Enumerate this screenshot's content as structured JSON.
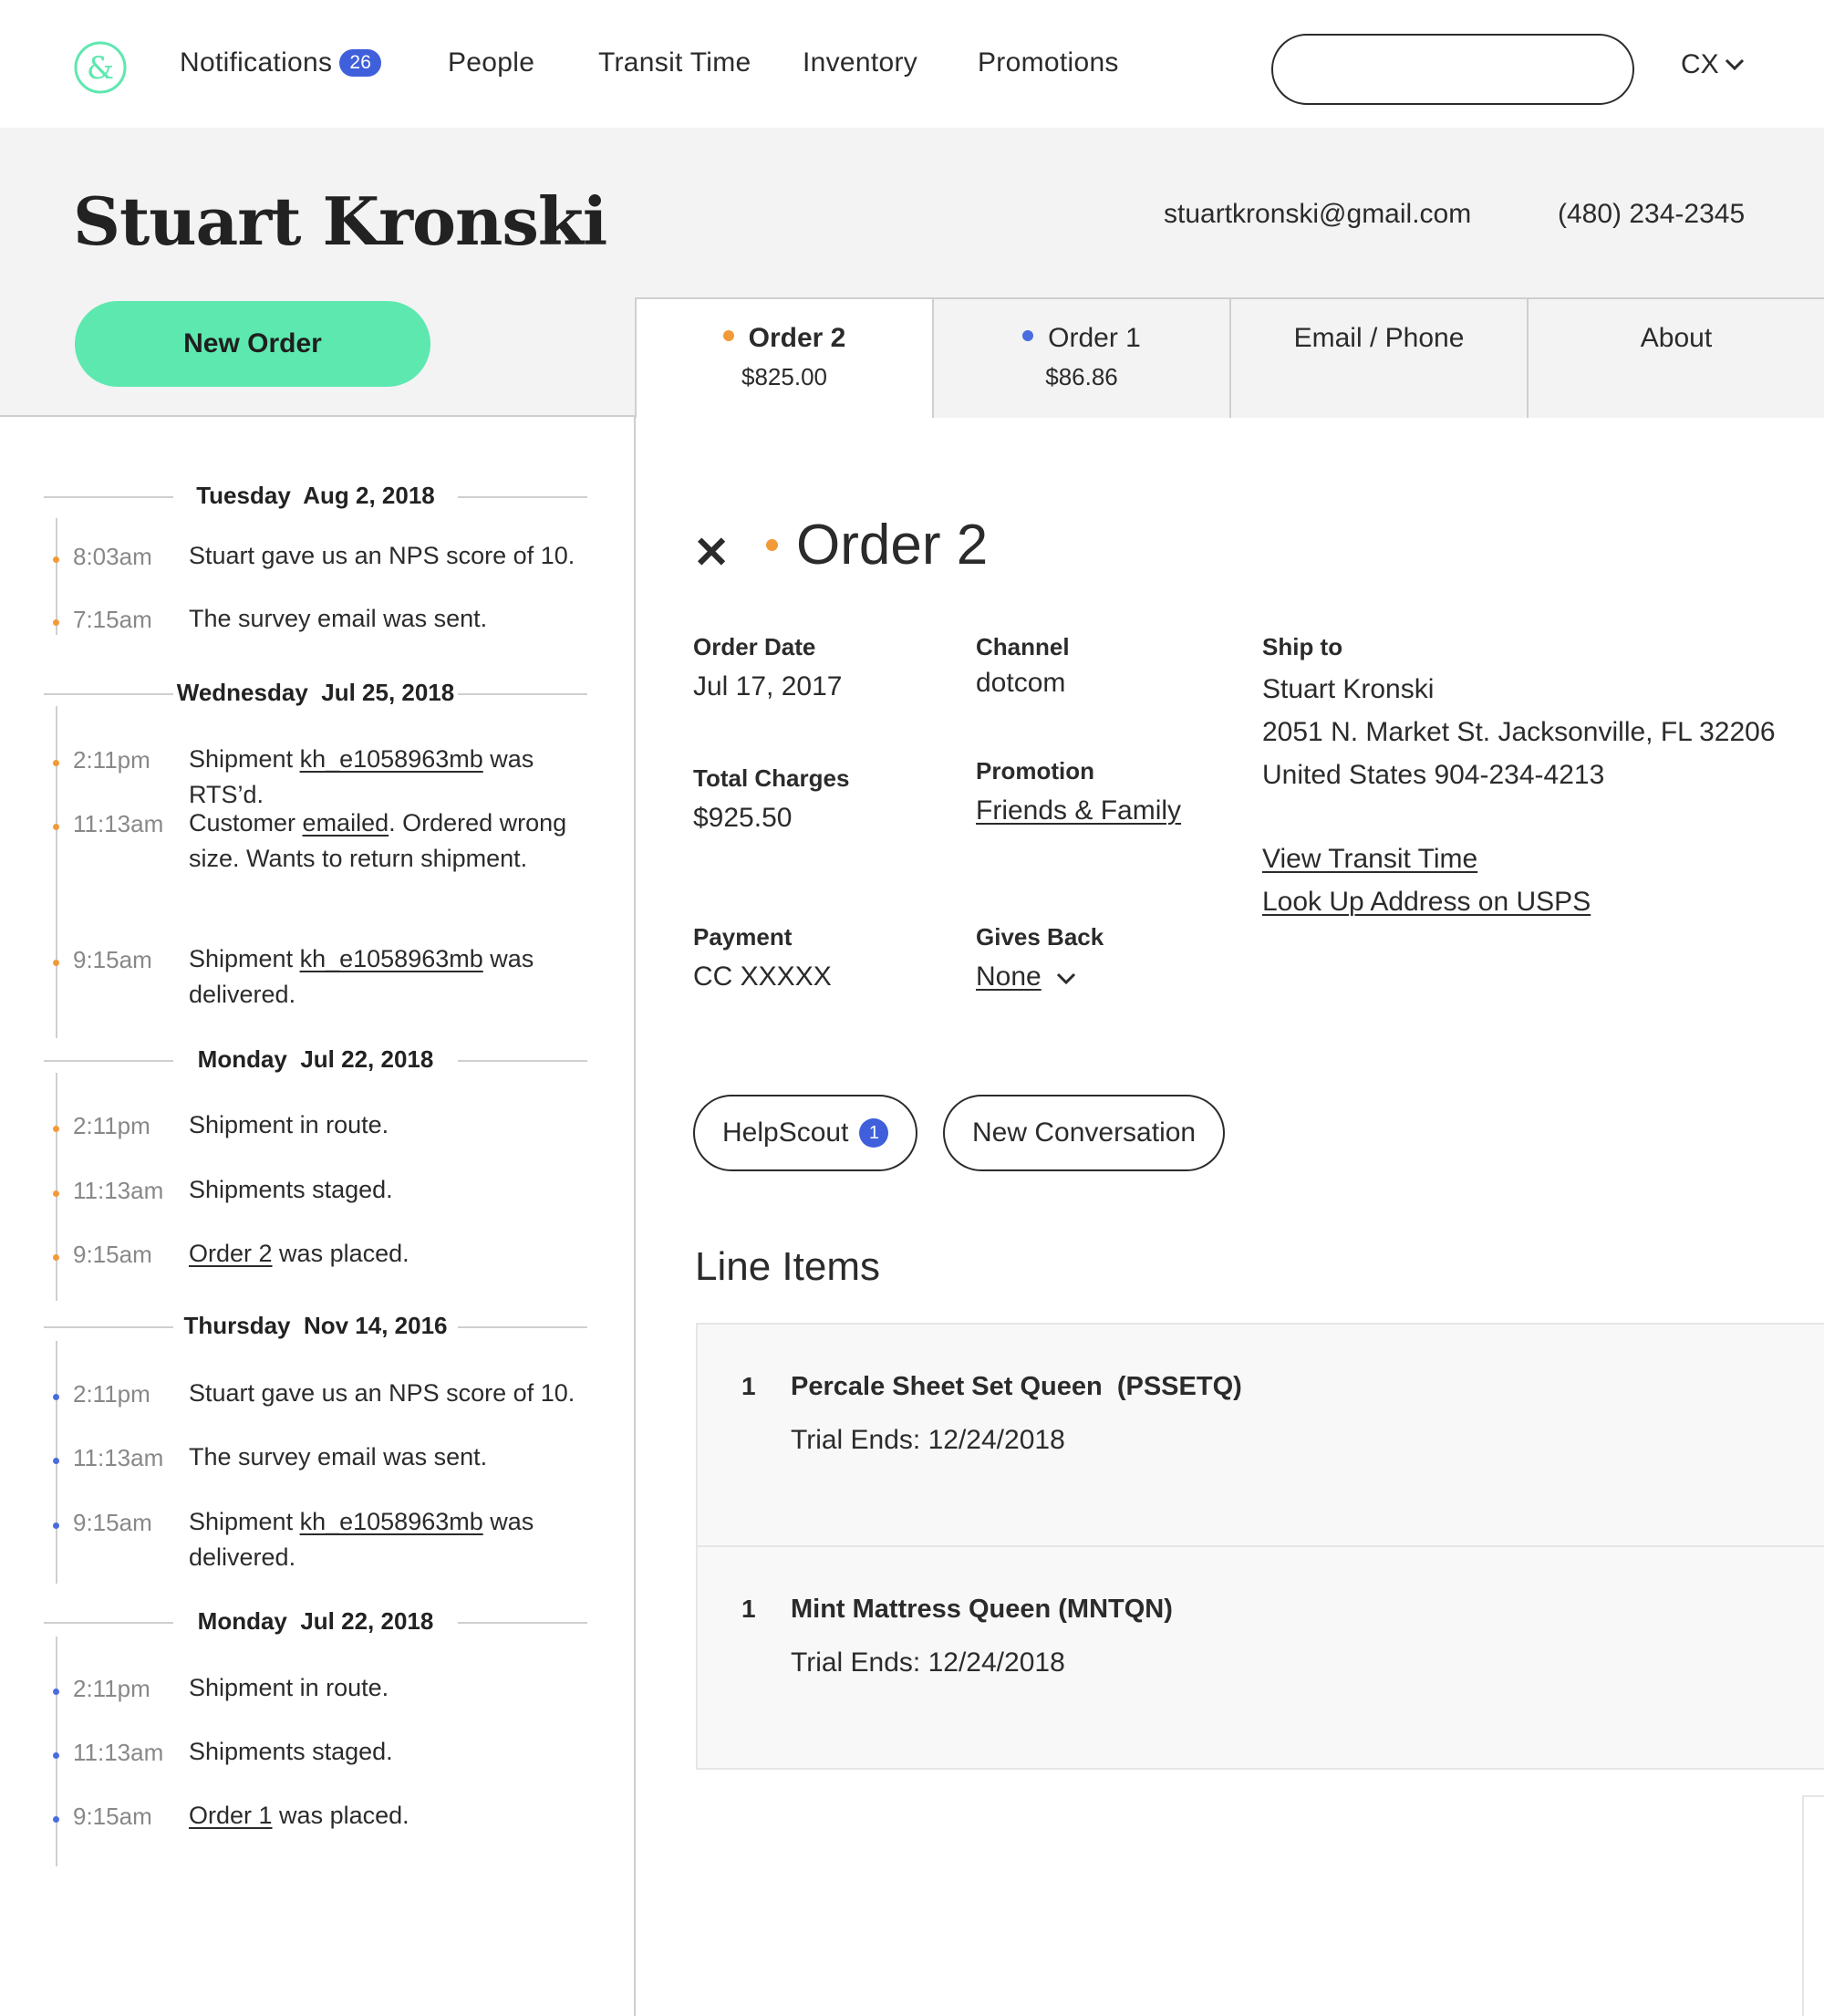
{
  "nav": {
    "logo_icon": "ampersand-logo-icon",
    "items": [
      {
        "label": "Notifications",
        "badge": "26"
      },
      {
        "label": "People"
      },
      {
        "label": "Transit Time"
      },
      {
        "label": "Inventory"
      },
      {
        "label": "Promotions"
      }
    ],
    "search": {
      "value": "",
      "placeholder": ""
    },
    "user_menu": "CX"
  },
  "customer": {
    "name": "Stuart Kronski",
    "email": "stuartkronski@gmail.com",
    "phone": "(480) 234-2345",
    "new_order_label": "New Order"
  },
  "tabs": [
    {
      "label": "Order 2",
      "sub": "$825.00",
      "dot": "orange",
      "active": true
    },
    {
      "label": "Order 1",
      "sub": "$86.86",
      "dot": "blue"
    },
    {
      "label": "Email / Phone"
    },
    {
      "label": "About"
    }
  ],
  "colors": {
    "accent_green": "#5de8b0",
    "order2_dot": "#f29a38",
    "order1_dot": "#4a6cdf",
    "badge_blue": "#3f5fdb"
  },
  "timeline": [
    {
      "date": "Tuesday  Aug 2, 2018",
      "events": [
        {
          "time": "8:03am",
          "parts": [
            {
              "t": "Stuart gave us an NPS score of 10."
            }
          ],
          "dot": "orange"
        },
        {
          "time": "7:15am",
          "parts": [
            {
              "t": "The survey email was sent."
            }
          ],
          "dot": "orange"
        }
      ]
    },
    {
      "date": "Wednesday  Jul 25, 2018",
      "events": [
        {
          "time": "2:11pm",
          "parts": [
            {
              "t": "Shipment "
            },
            {
              "t": "kh_e1058963mb",
              "link": true
            },
            {
              "t": " was RTS’d."
            }
          ],
          "dot": "orange"
        },
        {
          "time": "11:13am",
          "parts": [
            {
              "t": "Customer "
            },
            {
              "t": "emailed",
              "link": true
            },
            {
              "t": ". Ordered wrong size. Wants to return shipment."
            }
          ],
          "dot": "orange"
        },
        {
          "time": "9:15am",
          "parts": [
            {
              "t": "Shipment "
            },
            {
              "t": "kh_e1058963mb",
              "link": true
            },
            {
              "t": " was delivered."
            }
          ],
          "dot": "orange"
        }
      ]
    },
    {
      "date": "Monday  Jul 22, 2018",
      "events": [
        {
          "time": "2:11pm",
          "parts": [
            {
              "t": "Shipment in route."
            }
          ],
          "dot": "orange"
        },
        {
          "time": "11:13am",
          "parts": [
            {
              "t": "Shipments staged."
            }
          ],
          "dot": "orange"
        },
        {
          "time": "9:15am",
          "parts": [
            {
              "t": "Order 2",
              "link": true
            },
            {
              "t": " was placed."
            }
          ],
          "dot": "orange"
        }
      ]
    },
    {
      "date": "Thursday  Nov 14, 2016",
      "events": [
        {
          "time": "2:11pm",
          "parts": [
            {
              "t": "Stuart gave us an NPS score of 10."
            }
          ],
          "dot": "blue"
        },
        {
          "time": "11:13am",
          "parts": [
            {
              "t": "The survey email was sent."
            }
          ],
          "dot": "blue"
        },
        {
          "time": "9:15am",
          "parts": [
            {
              "t": "Shipment "
            },
            {
              "t": "kh_e1058963mb",
              "link": true
            },
            {
              "t": " was delivered."
            }
          ],
          "dot": "blue"
        }
      ]
    },
    {
      "date": "Monday  Jul 22, 2018",
      "events": [
        {
          "time": "2:11pm",
          "parts": [
            {
              "t": "Shipment in route."
            }
          ],
          "dot": "blue"
        },
        {
          "time": "11:13am",
          "parts": [
            {
              "t": "Shipments staged."
            }
          ],
          "dot": "blue"
        },
        {
          "time": "9:15am",
          "parts": [
            {
              "t": "Order 1",
              "link": true
            },
            {
              "t": " was placed."
            }
          ],
          "dot": "blue"
        }
      ]
    }
  ],
  "order": {
    "title": "Order 2",
    "close_icon": "close-icon",
    "order_date_label": "Order Date",
    "order_date": "Jul 17, 2017",
    "channel_label": "Channel",
    "channel": "dotcom",
    "total_label": "Total Charges",
    "total": "$925.50",
    "promotion_label": "Promotion",
    "promotion": "Friends & Family",
    "payment_label": "Payment",
    "payment": "CC XXXXX",
    "gives_back_label": "Gives Back",
    "gives_back": "None",
    "ship_to_label": "Ship to",
    "ship_name": "Stuart Kronski",
    "ship_address": "2051 N. Market St. Jacksonville, FL 32206",
    "ship_country_phone": "United States  904-234-4213",
    "view_transit_link": "View Transit Time",
    "usps_link": "Look Up Address on USPS",
    "helpscout_label": "HelpScout",
    "helpscout_badge": "1",
    "new_conversation_label": "New Conversation",
    "line_items_title": "Line Items",
    "line_items": [
      {
        "qty": "1",
        "name": "Percale Sheet Set Queen  (PSSETQ)",
        "trial": "Trial Ends: 12/24/2018"
      },
      {
        "qty": "1",
        "name": "Mint Mattress Queen (MNTQN)",
        "trial": "Trial Ends: 12/24/2018"
      }
    ]
  }
}
